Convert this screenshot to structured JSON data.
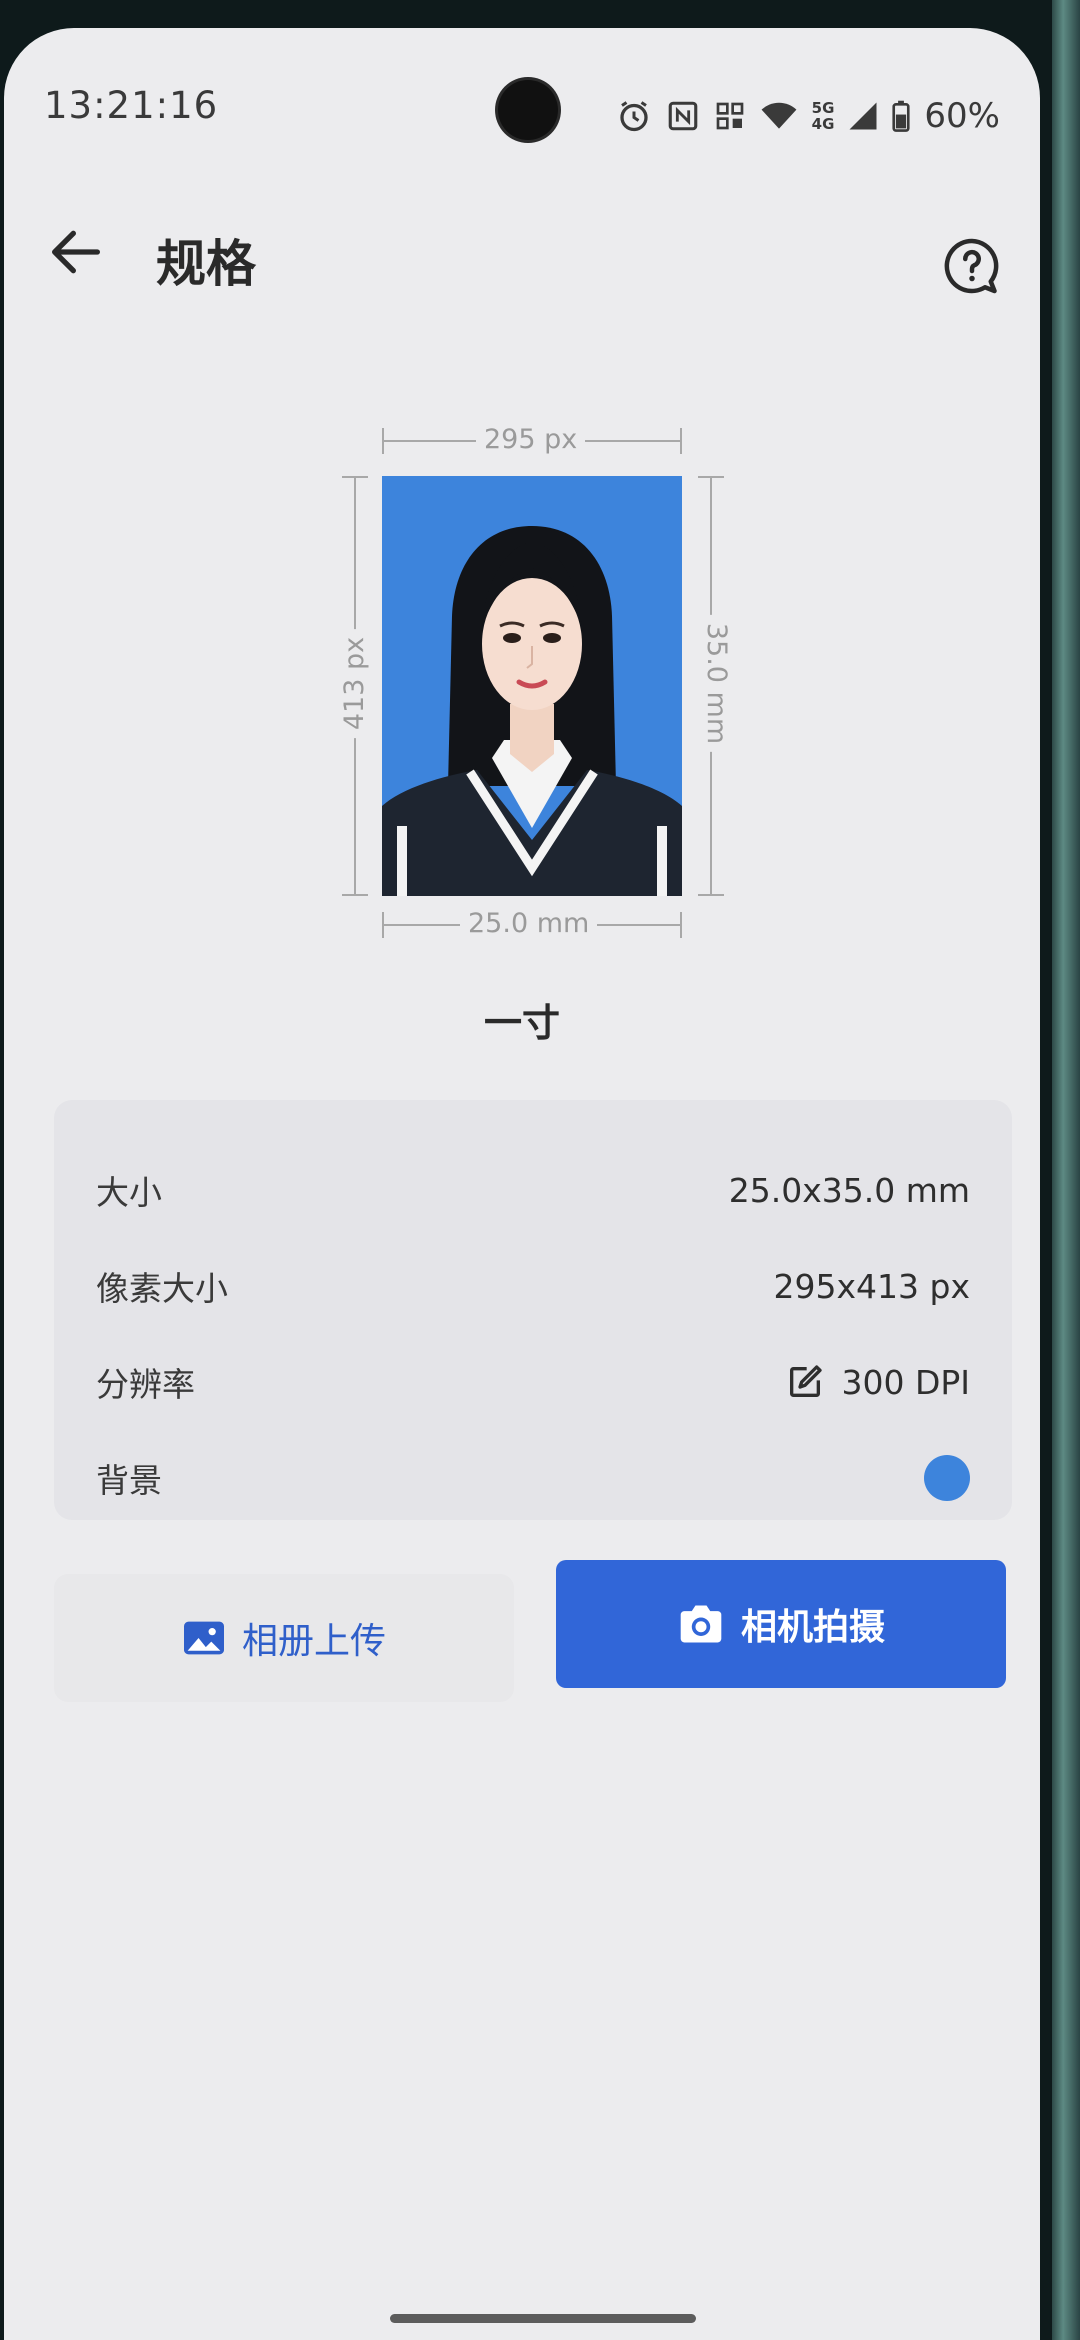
{
  "status_bar": {
    "time": "13:21:16",
    "battery": "60%",
    "signal_top": "5G",
    "signal_bottom": "4G"
  },
  "header": {
    "title": "规格"
  },
  "photo": {
    "width_px_label": "295 px",
    "height_px_label": "413 px",
    "width_mm_label": "25.0 mm",
    "height_mm_label": "35.0 mm",
    "background_color": "#3d84dc"
  },
  "spec_name": "一寸",
  "info": {
    "rows": [
      {
        "label": "大小",
        "value": "25.0x35.0 mm"
      },
      {
        "label": "像素大小",
        "value": "295x413 px"
      },
      {
        "label": "分辨率",
        "value": "300 DPI"
      },
      {
        "label": "背景",
        "value_color": "#3d84dc"
      }
    ]
  },
  "actions": {
    "album_label": "相册上传",
    "camera_label": "相机拍摄"
  },
  "colors": {
    "accent": "#3166d8",
    "photo_bg": "#3d84dc"
  }
}
